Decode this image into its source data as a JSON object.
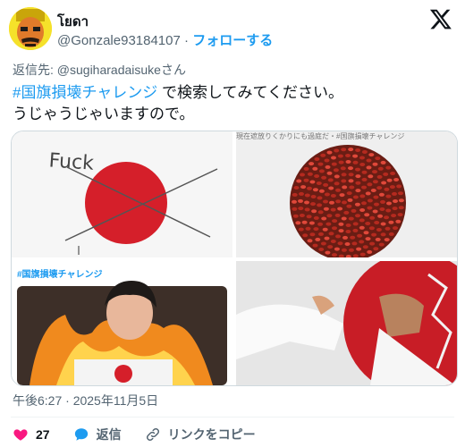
{
  "author": {
    "display_name": "โยดา",
    "handle": "@Gonzale93184107",
    "separator": "·",
    "follow_label": "フォローする"
  },
  "reply_to": "返信先: @sugiharadaisukeさん",
  "tweet": {
    "hashtag": "#国旗損壊チャレンジ",
    "text_after_hashtag": " で検索してみてください。",
    "line2": "うじゃうじゃいますので。"
  },
  "media": {
    "tile1_text": "Fuck",
    "tile2_strip": "現在遮放りくかりにも過庭だ・#国旗損壊チャレンジ",
    "tile3_hashtag": "#国旗損壊チャレンジ"
  },
  "timestamp": "午後6:27 · 2025年11月5日",
  "actions": {
    "like_count": "27",
    "reply_label": "返信",
    "copy_link_label": "リンクをコピー"
  },
  "colors": {
    "accent": "#1d9bf0",
    "like": "#f91880",
    "reply": "#1d9bf0",
    "flag_red": "#d51f2a"
  },
  "icons": [
    "avatar",
    "x-logo-icon",
    "heart-icon",
    "reply-icon",
    "link-icon"
  ]
}
